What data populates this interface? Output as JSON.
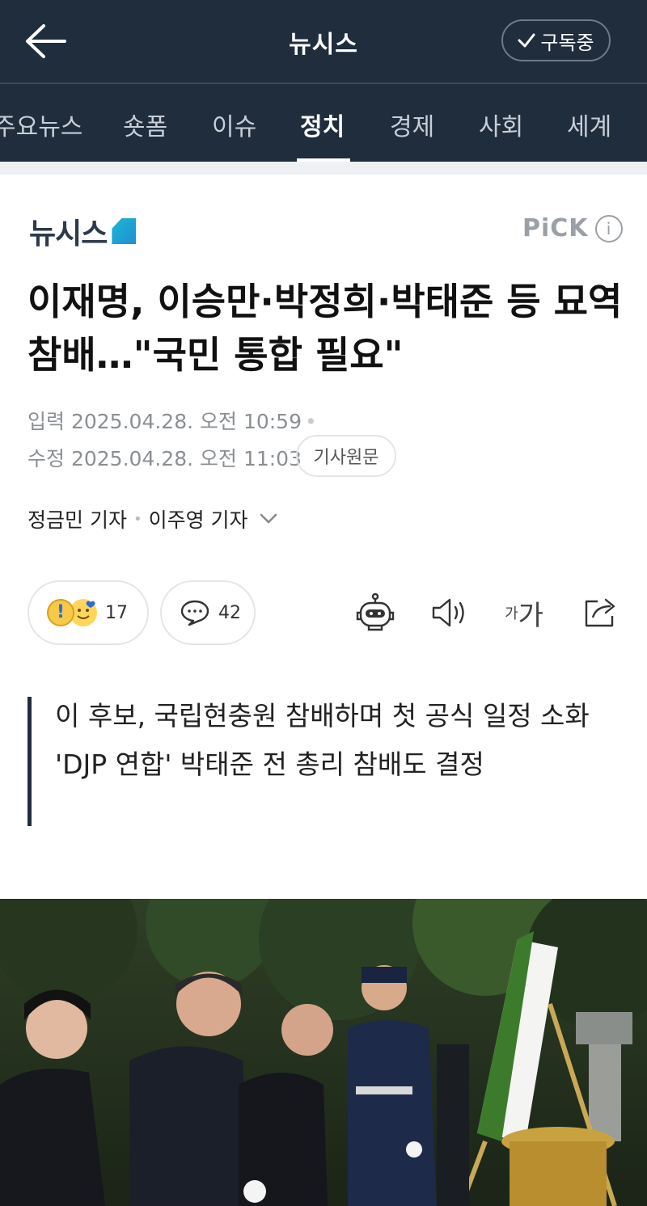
{
  "header": {
    "title": "뉴시스",
    "subscribe_label": "구독중"
  },
  "tabs": [
    {
      "label": "주요뉴스"
    },
    {
      "label": "숏폼"
    },
    {
      "label": "이슈"
    },
    {
      "label": "정치",
      "active": true
    },
    {
      "label": "경제"
    },
    {
      "label": "사회"
    },
    {
      "label": "세계"
    }
  ],
  "article": {
    "brand": "뉴시스",
    "pick_label": "PiCK",
    "pick_info": "i",
    "headline": "이재명, 이승만·박정희·박태준 등 묘역 참배…\"국민 통합 필요\"",
    "input_label": "입력",
    "input_time": "2025.04.28. 오전 10:59",
    "modified_label": "수정",
    "modified_time": "2025.04.28. 오전 11:03",
    "original_button": "기사원문",
    "reporters": [
      "정금민 기자",
      "이주영 기자"
    ],
    "reaction_count": "17",
    "comment_count": "42",
    "font_small": "가",
    "font_large": "가",
    "summary": [
      "이 후보, 국립현충원 참배하며 첫 공식 일정 소화",
      "'DJP 연합' 박태준 전 총리 참배도 결정"
    ]
  },
  "colors": {
    "header_bg": "#1f2d3d",
    "brand_accent": "#1fb6d6"
  }
}
